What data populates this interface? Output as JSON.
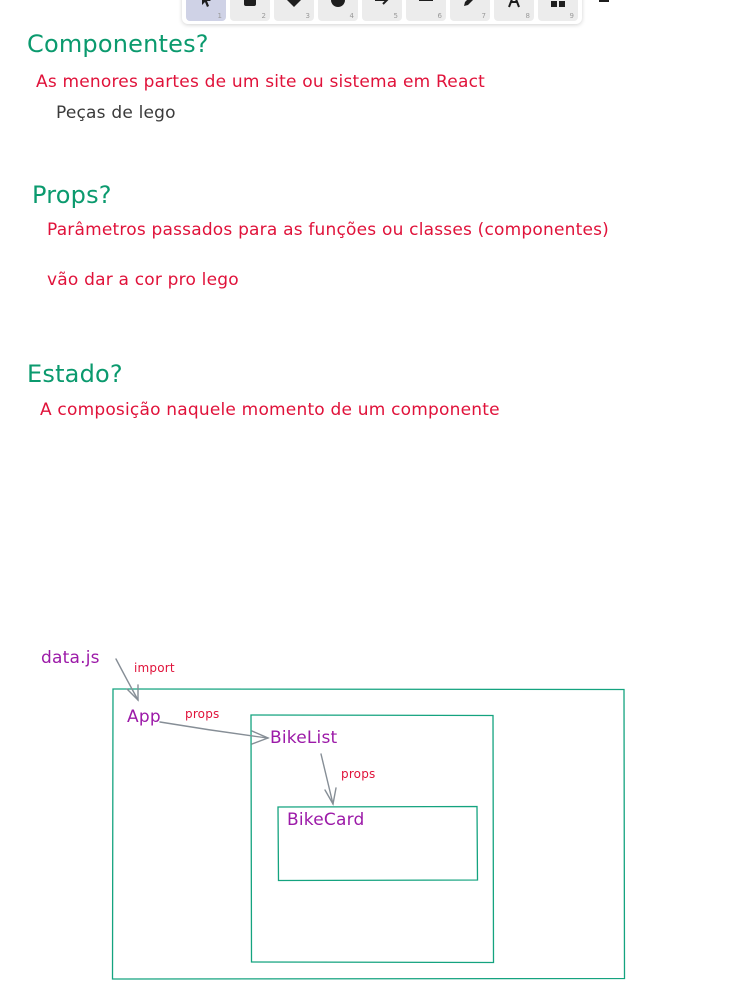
{
  "toolbar": {
    "tools": [
      {
        "icon": "pointer-icon",
        "key": "1"
      },
      {
        "icon": "rectangle-icon",
        "key": "2"
      },
      {
        "icon": "diamond-icon",
        "key": "3"
      },
      {
        "icon": "ellipse-icon",
        "key": "4"
      },
      {
        "icon": "arrow-icon",
        "key": "5"
      },
      {
        "icon": "line-icon",
        "key": "6"
      },
      {
        "icon": "pencil-icon",
        "key": "7"
      },
      {
        "icon": "text-icon",
        "key": "8"
      },
      {
        "icon": "library-icon",
        "key": "9"
      }
    ]
  },
  "notes": {
    "componentes": {
      "heading": "Componentes?",
      "line1": "As menores partes de um site ou sistema em React",
      "line2": "Peças de lego"
    },
    "props": {
      "heading": "Props?",
      "line1": "Parâmetros passados para as funções ou classes (componentes)",
      "line2": "vão dar a cor pro lego"
    },
    "estado": {
      "heading": "Estado?",
      "line1": "A composição naquele momento de um componente"
    }
  },
  "diagram": {
    "data_label": "data.js",
    "import_label": "import",
    "app_label": "App",
    "props_label_1": "props",
    "bikelist_label": "BikeList",
    "props_label_2": "props",
    "bikecard_label": "BikeCard"
  },
  "colors": {
    "heading": "#0b9a6e",
    "text_red": "#e0123a",
    "text_dark": "#3a3a3a",
    "purple": "#9c1aa8",
    "box_stroke": "#14a37f",
    "arrow": "#868e96"
  }
}
